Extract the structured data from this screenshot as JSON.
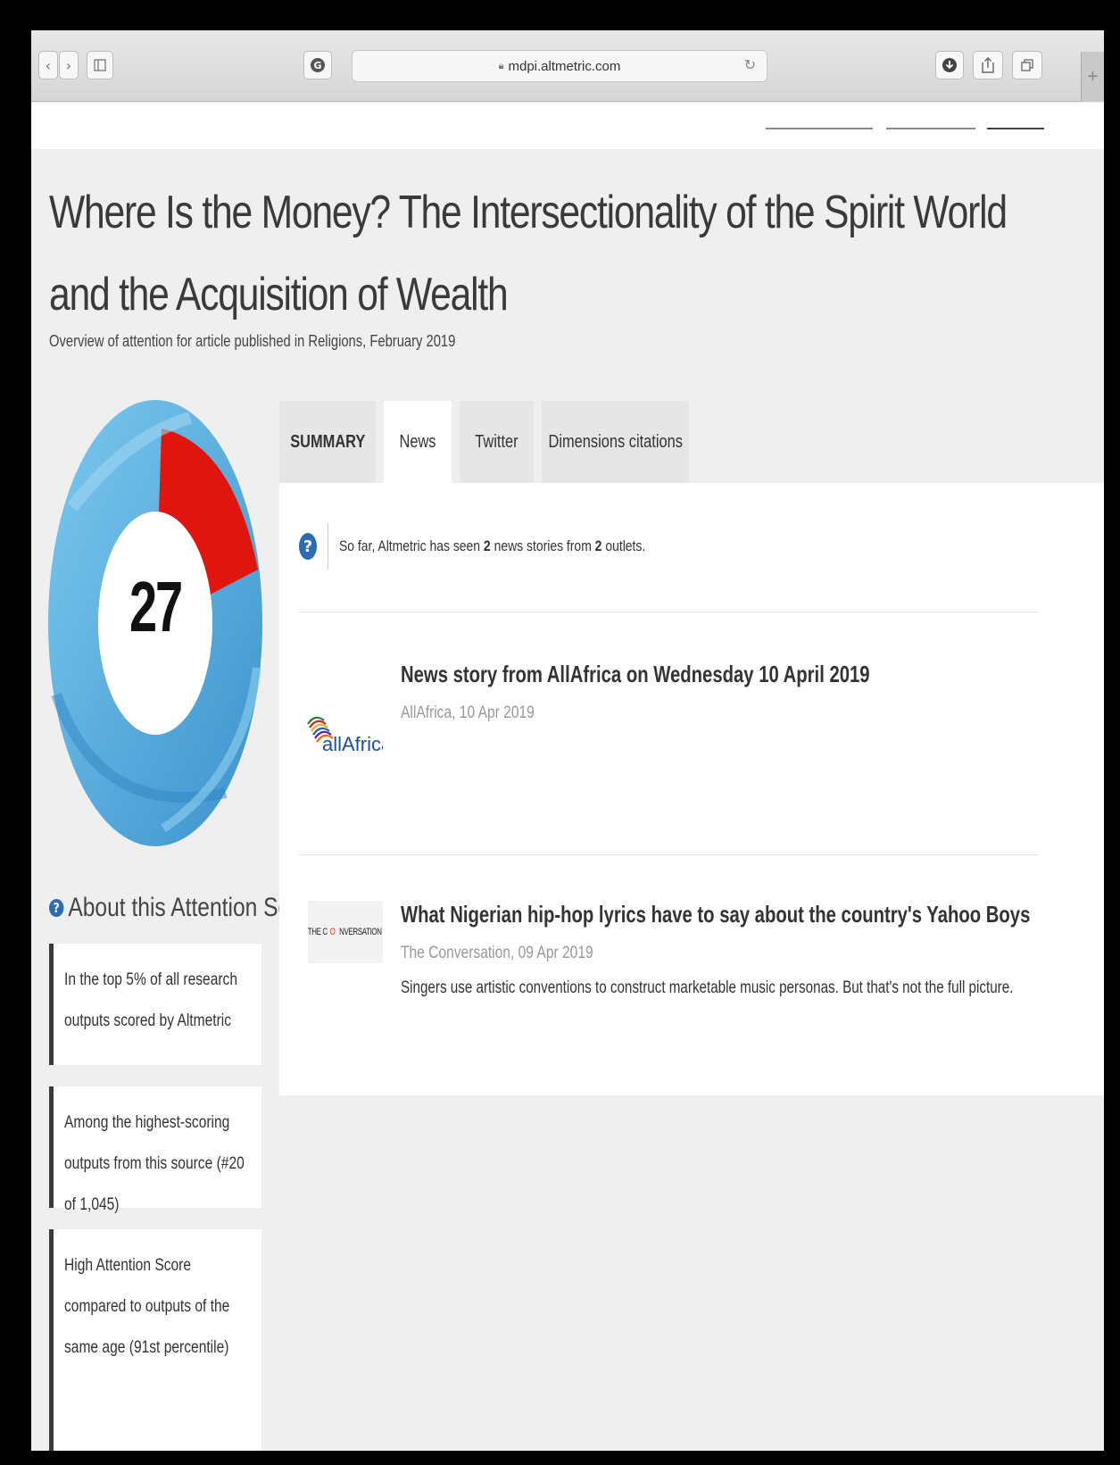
{
  "browser": {
    "url": "mdpi.altmetric.com",
    "back_icon": "chevron-left-icon",
    "forward_icon": "chevron-right-icon",
    "sidebar_icon": "sidebar-icon",
    "grammarly_icon": "g-icon",
    "reload_icon": "reload-icon",
    "download_icon": "download-icon",
    "share_icon": "share-icon",
    "tabs_icon": "tabs-icon",
    "new_tab_label": "+"
  },
  "article": {
    "title": "Where Is the Money? The Intersectionality of the Spirit World and the Acquisition of Wealth",
    "subtitle": "Overview of attention for article published in Religions, February 2019"
  },
  "score": {
    "value": "27",
    "colors": {
      "news": "#e0160e",
      "twitter": "#5ab4e5"
    }
  },
  "about": {
    "heading": "About this Attention Score",
    "cards": [
      {
        "text": "In the top 5% of all research outputs scored by Altmetric"
      },
      {
        "text": "Among the highest-scoring outputs from this source (#20 of 1,045)"
      },
      {
        "text": "High Attention Score compared to outputs of the same age (91st percentile)"
      }
    ]
  },
  "tabs": [
    {
      "label": "SUMMARY"
    },
    {
      "label": "News"
    },
    {
      "label": "Twitter"
    },
    {
      "label": "Dimensions citations"
    }
  ],
  "news": {
    "intro_prefix": "So far, Altmetric has seen ",
    "stories_count": "2",
    "intro_mid": " news stories from ",
    "outlets_count": "2",
    "intro_suffix": " outlets.",
    "stories": [
      {
        "outlet_logo": "allAfrica",
        "title": "News story from AllAfrica on Wednesday 10 April 2019",
        "meta": "AllAfrica, 10 Apr 2019",
        "description": ""
      },
      {
        "outlet_logo_prefix": "THE C",
        "outlet_logo_o": "O",
        "outlet_logo_suffix": "NVERSATION",
        "title": "What Nigerian hip-hop lyrics have to say about the country's Yahoo Boys",
        "meta": "The Conversation, 09 Apr 2019",
        "description": "Singers use artistic conventions to construct marketable music personas. But that's not the full picture."
      }
    ]
  }
}
